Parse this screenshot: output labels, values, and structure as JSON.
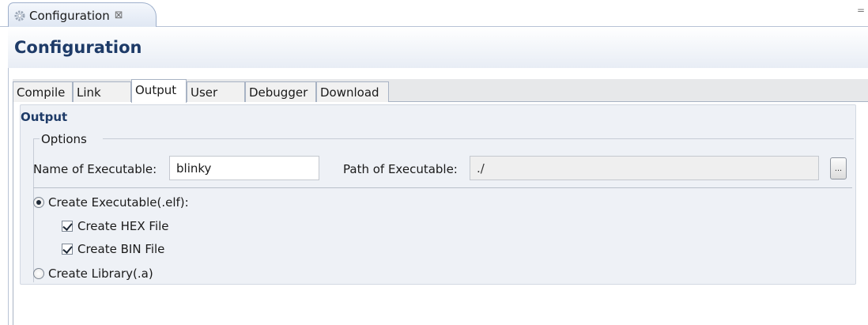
{
  "editor": {
    "tab_label": "Configuration",
    "tab_close": "⊠",
    "minimize": "="
  },
  "form": {
    "title": "Configuration",
    "tabs": [
      {
        "label": "Compile",
        "active": false
      },
      {
        "label": "Link",
        "active": false
      },
      {
        "label": "Output",
        "active": true
      },
      {
        "label": "User",
        "active": false
      },
      {
        "label": "Debugger",
        "active": false
      },
      {
        "label": "Download",
        "active": false
      }
    ]
  },
  "output": {
    "section_title": "Output",
    "group_label": "Options",
    "name_label": "Name of Executable:",
    "name_value": "blinky",
    "path_label": "Path of Executable:",
    "path_value": "./",
    "browse_label": "...",
    "create_executable": {
      "label": "Create Executable(.elf):",
      "selected": true
    },
    "create_hex": {
      "label": "Create HEX File",
      "checked": true
    },
    "create_bin": {
      "label": "Create BIN File",
      "checked": true
    },
    "create_library": {
      "label": "Create Library(.a)",
      "selected": false
    }
  }
}
